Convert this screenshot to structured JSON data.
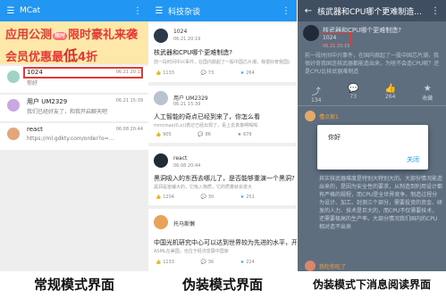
{
  "panel1": {
    "app_title": "MCat",
    "banner": {
      "line1_a": "应用公测",
      "line1_pill": "限时",
      "line1_b": "限时豪礼来袭",
      "line2_a": "会员优惠最",
      "line2_big": "低",
      "line2_b": "4折"
    },
    "chats": [
      {
        "name": "1024",
        "time": "06.21 20:19",
        "msg": "你好"
      },
      {
        "name": "用户 UM2329",
        "time": "06.21 15:39",
        "msg": "我们已经好友了，和我开启聊天吧"
      },
      {
        "name": "react",
        "time": "06.08 20:44",
        "msg": "https://ml.gdkty.com/order?o=..."
      }
    ],
    "caption": "常规模式界面"
  },
  "panel2": {
    "app_title": "科技杂谈",
    "cards": [
      {
        "user": "1024",
        "time": "06.21 20:19",
        "title": "核武器和CPU哪个更难制造?",
        "sub": "前一段时间中兴事件，在国内掀起了一股中国芯片潮，我很好奇我国连核武器都能造出来，为啥不会造CPU呢？",
        "s1": "1133",
        "s2": "73",
        "s3": "264"
      },
      {
        "user": "用户 UM2329",
        "time": "06.21 15:39",
        "title": "人工智能的奇点已经到来了，你怎么看",
        "sub": "mm(max(0,x))表达已经出现了，看上去真像啊喝喝",
        "s1": "905",
        "s2": "86",
        "s3": "679"
      },
      {
        "user": "react",
        "time": "06.08 20:44",
        "title": "黑洞吸入的东西去哪儿了，是否能够重演一个黑洞?",
        "sub": "黑洞是宙编大的，它吸入物质，它的质量就会变大",
        "s1": "1204",
        "s2": "30",
        "s3": "251"
      },
      {
        "user": "托马斯懒",
        "title": "中国光机研究中心可以达到世界较为先进的水平，开始",
        "sub": "ASML在美国，也位于经济发展中国家",
        "s1": "1133",
        "s2": "36",
        "s3": "224"
      }
    ],
    "caption": "伪装模式界面"
  },
  "panel3": {
    "app_title": "核武器和CPU哪个更难制造...",
    "post_title": "核武器和CPU哪个更难制造?",
    "post_user": "1024",
    "post_time": "06.21 20:19",
    "body": "前一段时间中兴事件，在国内掀起了一股中国芯片潮，我很好奇我国连核武器都能造出来，为啥不会造CPU呢？还是CPU比核武器难制造",
    "actions": [
      {
        "icon": "share",
        "label": "134"
      },
      {
        "icon": "comment",
        "label": "73"
      },
      {
        "icon": "like",
        "label": "264"
      },
      {
        "icon": "star",
        "label": "收藏"
      }
    ],
    "comment_user": "懂点家1",
    "comment_text": "其实核武器难度是特别大特别大的。大部份情况能造出来的，是因为安全性的要求，从制造到利用设计都有严格的规程，而CPU是全世界竞争，制造过程分为设计、加工、封测三个部分，需要投资的资金、研发的人力、技术是巨大的，而CPU不仅需要技术，还需要极高的生产率。大部分情况我们国内的CPU相对造不出来",
    "comment_user2": "我吃你吃了",
    "dialog": {
      "message": "你好",
      "button": "关闭"
    },
    "caption": "伪装模式下消息阅读界面"
  },
  "colors": {
    "appbar_blue": "#2196f3",
    "dark_appbar": "#3f4f61",
    "dark_bg": "#5e6e7f",
    "highlight_red": "#e53935"
  }
}
